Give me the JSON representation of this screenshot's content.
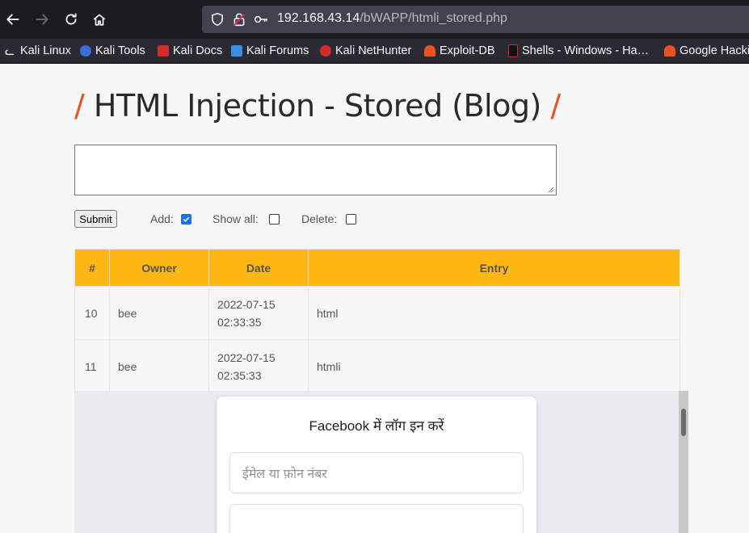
{
  "browser": {
    "url_host": "192.168.43.14",
    "url_path": "/bWAPP/htmli_stored.php",
    "bookmarks": [
      {
        "label": "Kali Linux",
        "icon": "kali-dragon-icon",
        "color": "#9a9a9a"
      },
      {
        "label": "Kali Tools",
        "icon": "kali-tools-icon",
        "color": "#3b6fd8"
      },
      {
        "label": "Kali Docs",
        "icon": "kali-docs-icon",
        "color": "#d12b2b"
      },
      {
        "label": "Kali Forums",
        "icon": "kali-forums-icon",
        "color": "#3b8fe0"
      },
      {
        "label": "Kali NetHunter",
        "icon": "kali-nethunter-icon",
        "color": "#d12b2b"
      },
      {
        "label": "Exploit-DB",
        "icon": "exploit-db-icon",
        "color": "#e8531f"
      },
      {
        "label": "Shells - Windows - Ha…",
        "icon": "shells-icon",
        "color": "#111111"
      },
      {
        "label": "Google Hacki",
        "icon": "google-hacking-icon",
        "color": "#e8531f"
      }
    ]
  },
  "page": {
    "title_slash_left": "/",
    "title": "HTML Injection - Stored (Blog)",
    "title_slash_right": "/",
    "submit_label": "Submit",
    "add_label": "Add:",
    "add_checked": true,
    "show_all_label": "Show all:",
    "show_all_checked": false,
    "delete_label": "Delete:",
    "delete_checked": false,
    "accent_color": "#ffb714"
  },
  "table": {
    "headers": [
      "#",
      "Owner",
      "Date",
      "Entry"
    ],
    "rows": [
      {
        "num": "10",
        "owner": "bee",
        "date_line1": "2022-07-15",
        "date_line2": "02:33:35",
        "entry": "html"
      },
      {
        "num": "11",
        "owner": "bee",
        "date_line1": "2022-07-15",
        "date_line2": "02:35:33",
        "entry": "htmli"
      }
    ]
  },
  "injected_form": {
    "title": "Facebook में लॉग इन करें",
    "email_placeholder": "ईमेल या फ़ोन नंबर",
    "password_placeholder": ""
  }
}
